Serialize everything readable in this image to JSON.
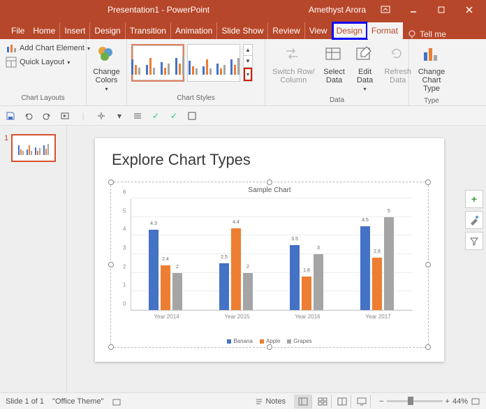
{
  "title_left": "Presentation1 - PowerPoint",
  "user": "Amethyst Arora",
  "tabs": [
    "File",
    "Home",
    "Insert",
    "Design",
    "Transition",
    "Animation",
    "Slide Show",
    "Review",
    "View",
    "Design",
    "Format"
  ],
  "tellme": "Tell me",
  "ribbon": {
    "add_chart_element": "Add Chart Element",
    "quick_layout": "Quick Layout",
    "chart_layouts": "Chart Layouts",
    "change_colors": "Change Colors",
    "chart_styles": "Chart Styles",
    "switch": "Switch Row/\nColumn",
    "select_data": "Select Data",
    "edit_data": "Edit Data",
    "refresh_data": "Refresh Data",
    "data": "Data",
    "change_chart_type": "Change Chart Type",
    "type": "Type"
  },
  "slide": {
    "number": "1",
    "heading": "Explore Chart Types",
    "chart_title": "Sample Chart"
  },
  "chart_data": {
    "type": "bar",
    "title": "Sample Chart",
    "xlabel": "",
    "ylabel": "",
    "ylim": [
      0,
      6
    ],
    "categories": [
      "Year 2014",
      "Year 2015",
      "Year 2016",
      "Year 2017"
    ],
    "series": [
      {
        "name": "Banana",
        "color": "#4472C4",
        "values": [
          4.3,
          2.5,
          3.5,
          4.5
        ]
      },
      {
        "name": "Apple",
        "color": "#ED7D31",
        "values": [
          2.4,
          4.4,
          1.8,
          2.8
        ]
      },
      {
        "name": "Grapes",
        "color": "#A5A5A5",
        "values": [
          2,
          2,
          3,
          5
        ]
      }
    ]
  },
  "status": {
    "slide": "Slide 1 of 1",
    "theme": "\"Office Theme\"",
    "notes": "Notes",
    "zoom": "44%"
  }
}
